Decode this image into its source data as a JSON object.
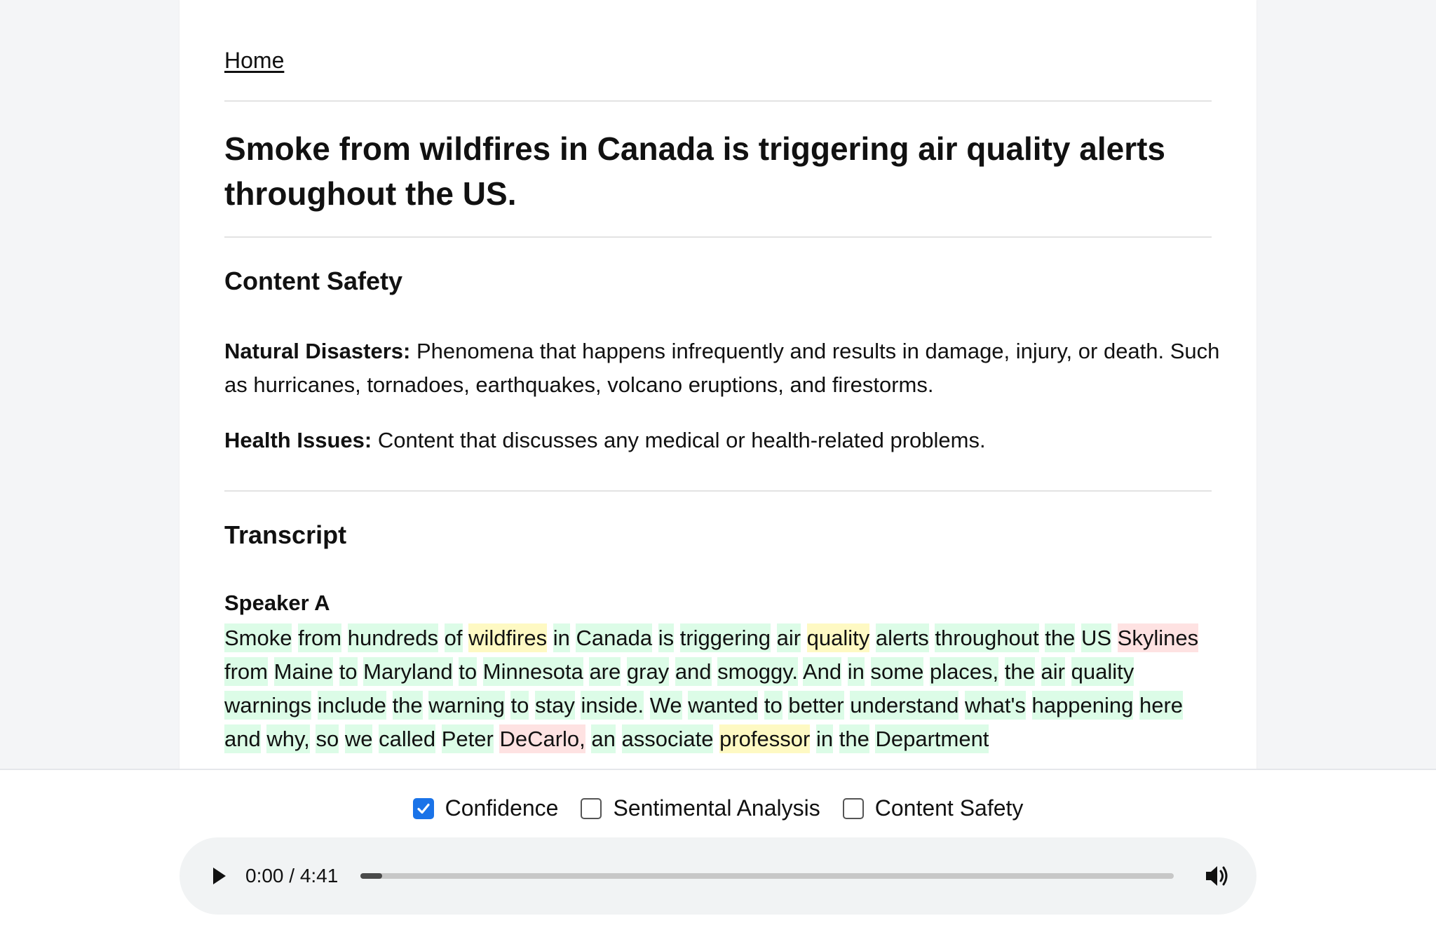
{
  "nav": {
    "home_label": "Home"
  },
  "article": {
    "title": "Smoke from wildfires in Canada is triggering air quality alerts throughout the US."
  },
  "content_safety": {
    "heading": "Content Safety",
    "items": [
      {
        "label": "Natural Disasters:",
        "description": "Phenomena that happens infrequently and results in damage, injury, or death. Such as hurricanes, tornadoes, earthquakes, volcano eruptions, and firestorms."
      },
      {
        "label": "Health Issues:",
        "description": "Content that discusses any medical or health-related problems."
      }
    ]
  },
  "transcript": {
    "heading": "Transcript",
    "speaker": "Speaker A",
    "confidence_colors": {
      "g": "#dcfce7",
      "y": "#fef9c3",
      "r": "#fee2e2"
    },
    "words": [
      {
        "t": "Smoke",
        "c": "g"
      },
      {
        "t": "from",
        "c": "g"
      },
      {
        "t": "hundreds",
        "c": "g"
      },
      {
        "t": "of",
        "c": "g"
      },
      {
        "t": "wildfires",
        "c": "y"
      },
      {
        "t": "in",
        "c": "g"
      },
      {
        "t": "Canada",
        "c": "g"
      },
      {
        "t": "is",
        "c": "g"
      },
      {
        "t": "triggering",
        "c": "g"
      },
      {
        "t": "air",
        "c": "g"
      },
      {
        "t": "quality",
        "c": "y"
      },
      {
        "t": "alerts",
        "c": "g"
      },
      {
        "t": "throughout",
        "c": "g"
      },
      {
        "t": "the",
        "c": "g"
      },
      {
        "t": "US",
        "c": "g"
      },
      {
        "t": "Skylines",
        "c": "r"
      },
      {
        "t": "from",
        "c": "g"
      },
      {
        "t": "Maine",
        "c": "g"
      },
      {
        "t": "to",
        "c": "g"
      },
      {
        "t": "Maryland",
        "c": "g"
      },
      {
        "t": "to",
        "c": "g"
      },
      {
        "t": "Minnesota",
        "c": "g"
      },
      {
        "t": "are",
        "c": "g"
      },
      {
        "t": "gray",
        "c": "g"
      },
      {
        "t": "and",
        "c": "g"
      },
      {
        "t": "smoggy.",
        "c": "g"
      },
      {
        "t": "And",
        "c": "g"
      },
      {
        "t": "in",
        "c": "g"
      },
      {
        "t": "some",
        "c": "g"
      },
      {
        "t": "places,",
        "c": "g"
      },
      {
        "t": "the",
        "c": "g"
      },
      {
        "t": "air",
        "c": "g"
      },
      {
        "t": "quality",
        "c": "g"
      },
      {
        "t": "warnings",
        "c": "g"
      },
      {
        "t": "include",
        "c": "g"
      },
      {
        "t": "the",
        "c": "g"
      },
      {
        "t": "warning",
        "c": "g"
      },
      {
        "t": "to",
        "c": "g"
      },
      {
        "t": "stay",
        "c": "g"
      },
      {
        "t": "inside.",
        "c": "g"
      },
      {
        "t": "We",
        "c": "g"
      },
      {
        "t": "wanted",
        "c": "g"
      },
      {
        "t": "to",
        "c": "g"
      },
      {
        "t": "better",
        "c": "g"
      },
      {
        "t": "understand",
        "c": "g"
      },
      {
        "t": "what's",
        "c": "g"
      },
      {
        "t": "happening",
        "c": "g"
      },
      {
        "t": "here",
        "c": "g"
      },
      {
        "t": "and",
        "c": "g"
      },
      {
        "t": "why,",
        "c": "g"
      },
      {
        "t": "so",
        "c": "g"
      },
      {
        "t": "we",
        "c": "g"
      },
      {
        "t": "called",
        "c": "g"
      },
      {
        "t": "Peter",
        "c": "g"
      },
      {
        "t": "DeCarlo,",
        "c": "r"
      },
      {
        "t": "an",
        "c": "g"
      },
      {
        "t": "associate",
        "c": "g"
      },
      {
        "t": "professor",
        "c": "y"
      },
      {
        "t": "in",
        "c": "g"
      },
      {
        "t": "the",
        "c": "g"
      },
      {
        "t": "Department",
        "c": "g"
      }
    ]
  },
  "toggles": [
    {
      "label": "Confidence",
      "checked": true
    },
    {
      "label": "Sentimental Analysis",
      "checked": false
    },
    {
      "label": "Content Safety",
      "checked": false
    }
  ],
  "audio": {
    "time_display": "0:00 / 4:41",
    "progress_fraction": 0.027
  }
}
